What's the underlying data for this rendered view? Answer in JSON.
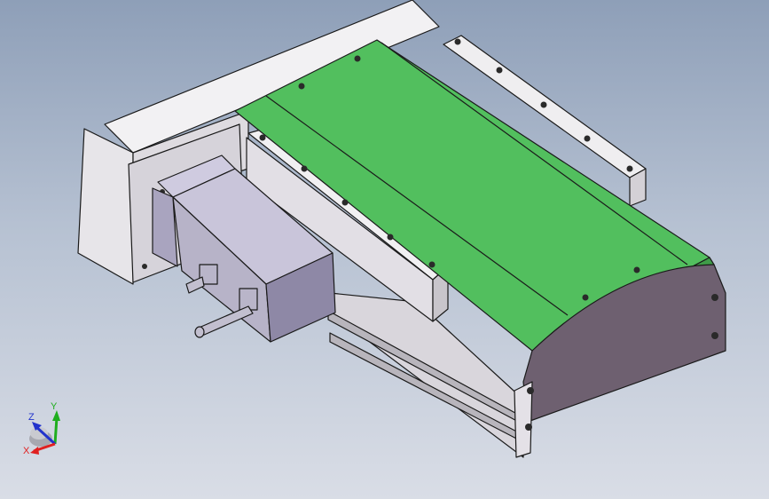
{
  "viewport": {
    "background_top": "#8e9fb8",
    "background_bottom": "#d9dde6"
  },
  "model": {
    "colors": {
      "carriage_green": "#52bf5e",
      "carriage_green_dark": "#3f9c48",
      "rail_light": "#ecebec",
      "rail_shade": "#c9c6cb",
      "end_cap": "#6e6070",
      "motor_body": "#b7b3c8",
      "motor_dark": "#8e88a6",
      "outline": "#1a1a1a"
    }
  },
  "triad": {
    "x_label": "X",
    "y_label": "Y",
    "z_label": "Z",
    "x_color": "#e02020",
    "y_color": "#1fae1f",
    "z_color": "#2233cc"
  }
}
